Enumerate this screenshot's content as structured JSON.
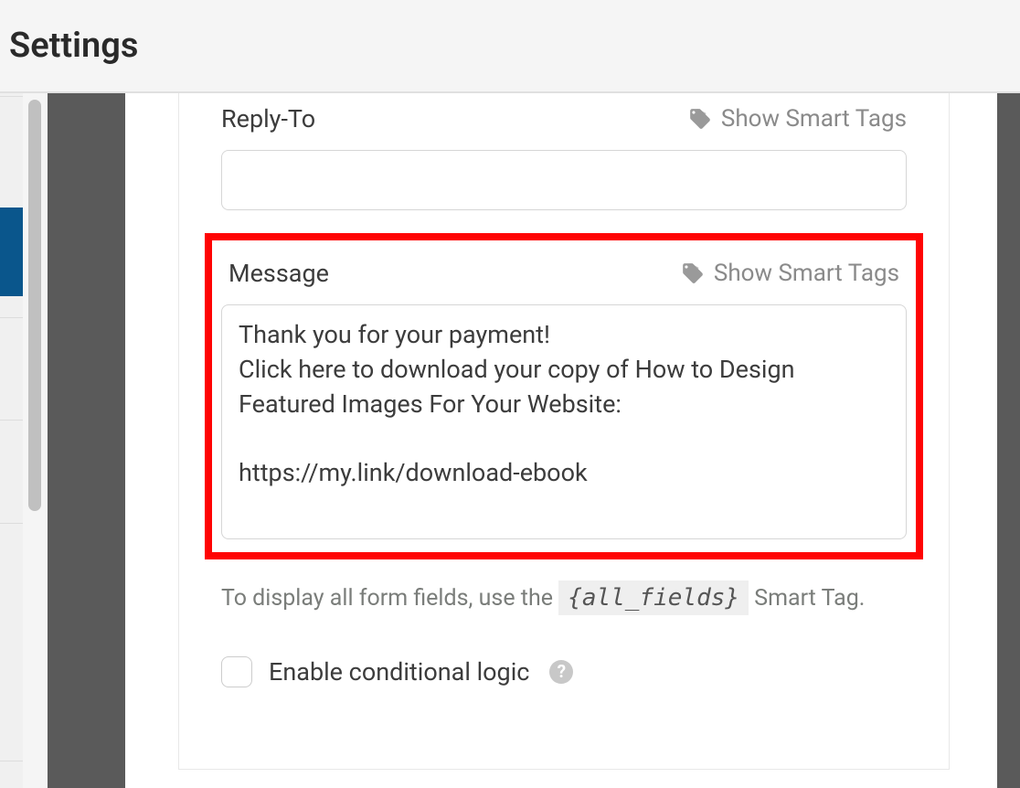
{
  "header": {
    "title": "Settings"
  },
  "fields": {
    "reply_to": {
      "label": "Reply-To",
      "value": "",
      "smart_tags_label": "Show Smart Tags"
    },
    "message": {
      "label": "Message",
      "value": "Thank you for your payment!\nClick here to download your copy of How to Design Featured Images For Your Website:\n\nhttps://my.link/download-ebook",
      "smart_tags_label": "Show Smart Tags"
    }
  },
  "helper": {
    "prefix": "To display all form fields, use the ",
    "tag": "{all_fields}",
    "suffix": " Smart Tag."
  },
  "conditional_logic": {
    "label": "Enable conditional logic",
    "checked": false
  }
}
